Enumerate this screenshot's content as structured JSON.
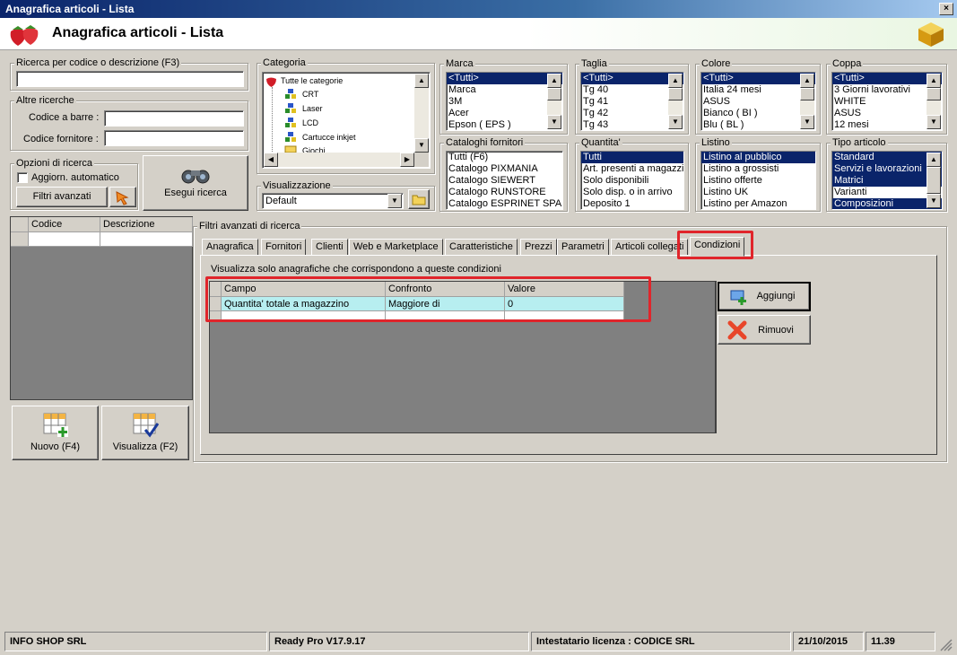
{
  "window": {
    "title": "Anagrafica articoli  - Lista",
    "close": "×"
  },
  "header": {
    "title": "Anagrafica articoli  - Lista"
  },
  "search": {
    "label": "Ricerca per codice o descrizione (F3)",
    "value": ""
  },
  "other": {
    "label": "Altre ricerche",
    "barcode_label": "Codice a barre :",
    "supplier_label": "Codice fornitore :"
  },
  "options": {
    "label": "Opzioni di ricerca",
    "auto_update": "Aggiorn. automatico",
    "advanced": "Filtri avanzati",
    "search_btn": "Esegui ricerca"
  },
  "category": {
    "label": "Categoria",
    "items": [
      "Tutte le categorie",
      "CRT",
      "Laser",
      "LCD",
      "Cartucce inkjet",
      "Giochi"
    ]
  },
  "view": {
    "label": "Visualizzazione",
    "value": "Default"
  },
  "lists": {
    "marca": {
      "label": "Marca",
      "items": [
        "<Tutti>",
        "Marca",
        "3M",
        "Acer",
        "Epson ( EPS )"
      ]
    },
    "taglia": {
      "label": "Taglia",
      "items": [
        "<Tutti>",
        "Tg 40",
        "Tg 41",
        "Tg 42",
        "Tg 43"
      ]
    },
    "colore": {
      "label": "Colore",
      "items": [
        "<Tutti>",
        "Italia 24 mesi",
        "ASUS",
        "Bianco ( BI )",
        "Blu ( BL )"
      ]
    },
    "coppa": {
      "label": "Coppa",
      "items": [
        "<Tutti>",
        "3 Giorni lavorativi",
        "WHITE",
        "ASUS",
        "12 mesi"
      ]
    },
    "cataloghi": {
      "label": "Cataloghi fornitori",
      "items": [
        "Tutti (F6)",
        "Catalogo PIXMANIA",
        "Catalogo SIEWERT",
        "Catalogo RUNSTORE",
        "Catalogo ESPRINET SPA"
      ]
    },
    "quantita": {
      "label": "Quantita'",
      "items": [
        "Tutti",
        "Art. presenti a magazzino",
        "Solo disponibili",
        "Solo disp. o in arrivo",
        "Deposito 1"
      ]
    },
    "listino": {
      "label": "Listino",
      "items": [
        "Listino al pubblico",
        "Listino a grossisti",
        "Listino offerte",
        "Listino UK",
        "Listino per Amazon"
      ]
    },
    "tipo": {
      "label": "Tipo articolo",
      "items": [
        "Standard",
        "Servizi e lavorazioni",
        "Matrici",
        "Varianti",
        "Composizioni"
      ]
    }
  },
  "grid": {
    "col1": "Codice",
    "col2": "Descrizione"
  },
  "buttons": {
    "new": "Nuovo (F4)",
    "view": "Visualizza (F2)",
    "add": "Aggiungi",
    "remove": "Rimuovi"
  },
  "filters": {
    "label": "Filtri avanzati di ricerca",
    "tabs": [
      "Anagrafica",
      "Fornitori",
      "Clienti",
      "Web e Marketplace",
      "Caratteristiche",
      "Prezzi",
      "Parametri",
      "Articoli collegati",
      "Condizioni"
    ],
    "description": "Visualizza solo anagrafiche che corrispondono a queste condizioni",
    "columns": [
      "Campo",
      "Confronto",
      "Valore"
    ],
    "row": [
      "Quantita' totale a magazzino",
      "Maggiore di",
      "0"
    ]
  },
  "status": {
    "company": "INFO SHOP SRL",
    "version": "Ready Pro V17.9.17",
    "license": "Intestatario licenza : CODICE SRL",
    "date": "21/10/2015",
    "time": "11.39"
  },
  "colors": {
    "selection": "#0a246a",
    "highlight_row": "#b7eef0",
    "annotation": "#e0252b"
  }
}
